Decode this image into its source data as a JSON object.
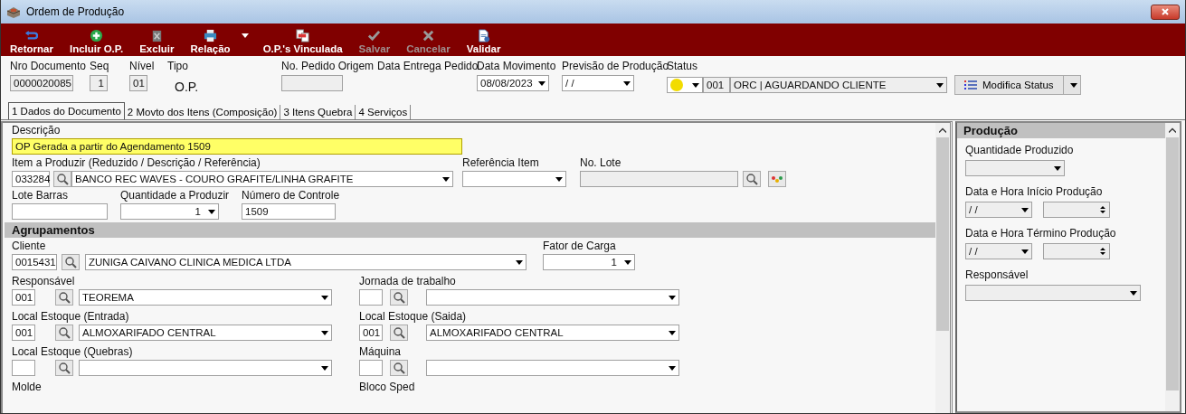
{
  "window": {
    "title": "Ordem de Produção"
  },
  "toolbar": [
    {
      "label": "Retornar",
      "disabled": false,
      "has_menu": false
    },
    {
      "label": "Incluir O.P.",
      "disabled": false,
      "has_menu": false
    },
    {
      "label": "Excluir",
      "disabled": false,
      "has_menu": false
    },
    {
      "label": "Relação",
      "disabled": false,
      "has_menu": true
    },
    {
      "label": "O.P.'s Vinculada",
      "disabled": false,
      "has_menu": false
    },
    {
      "label": "Salvar",
      "disabled": true,
      "has_menu": false
    },
    {
      "label": "Cancelar",
      "disabled": true,
      "has_menu": false
    },
    {
      "label": "Validar",
      "disabled": false,
      "has_menu": false
    }
  ],
  "header": {
    "nro_documento": {
      "label": "Nro Documento",
      "value": "0000020085"
    },
    "seq": {
      "label": "Seq",
      "value": "1"
    },
    "nivel": {
      "label": "Nível",
      "value": "01"
    },
    "tipo": {
      "label": "Tipo",
      "value": "O.P."
    },
    "pedido_origem": {
      "label": "No. Pedido Origem"
    },
    "data_entrega": {
      "label": "Data Entrega Pedido"
    },
    "data_movimento": {
      "label": "Data Movimento",
      "value": "08/08/2023"
    },
    "previsao": {
      "label": "Previsão de Produção",
      "value": "/ /"
    },
    "status": {
      "label": "Status",
      "color": "#f2dc00",
      "code": "001",
      "value": "ORC | AGUARDANDO CLIENTE"
    },
    "modifica_status": "Modifica Status"
  },
  "tabs": [
    {
      "label": "1 Dados do Documento",
      "selected": true
    },
    {
      "label": "2 Movto dos Itens (Composição)",
      "selected": false
    },
    {
      "label": "3 Itens Quebra",
      "selected": false
    },
    {
      "label": "4 Serviços",
      "selected": false
    }
  ],
  "documento": {
    "descricao": {
      "label": "Descrição",
      "value": "OP Gerada a partir do Agendamento 1509"
    },
    "item": {
      "label": "Item a Produzir (Reduzido / Descrição / Referência)",
      "code": "033284",
      "value": "BANCO REC WAVES - COURO GRAFITE/LINHA GRAFITE"
    },
    "referencia": {
      "label": "Referência Item"
    },
    "lote": {
      "label": "No. Lote"
    },
    "lote_barras": {
      "label": "Lote Barras"
    },
    "quantidade": {
      "label": "Quantidade a Produzir",
      "value": "1"
    },
    "controle": {
      "label": "Número de Controle",
      "value": "1509"
    }
  },
  "agrupamentos": {
    "title": "Agrupamentos",
    "cliente": {
      "label": "Cliente",
      "code": "0015431",
      "value": "ZUNIGA CAIVANO CLINICA MEDICA LTDA"
    },
    "fator_carga": {
      "label": "Fator de Carga",
      "value": "1"
    },
    "pairs": [
      [
        {
          "label": "Responsável",
          "code": "001",
          "value": "TEOREMA"
        },
        {
          "label": "Jornada de trabalho"
        }
      ],
      [
        {
          "label": "Local Estoque (Entrada)",
          "code": "001",
          "value": "ALMOXARIFADO CENTRAL"
        },
        {
          "label": "Local Estoque (Saida)",
          "code": "001",
          "value": "ALMOXARIFADO CENTRAL"
        }
      ],
      [
        {
          "label": "Local Estoque (Quebras)"
        },
        {
          "label": "Máquina"
        }
      ]
    ],
    "molde": {
      "label": "Molde"
    },
    "bloco_sped": {
      "label": "Bloco Sped"
    }
  },
  "producao": {
    "title": "Produção",
    "quantidade": {
      "label": "Quantidade Produzido"
    },
    "inicio": {
      "label": "Data e Hora Início Produção",
      "date": "/ /"
    },
    "termino": {
      "label": "Data e Hora Término Produção",
      "date": "/ /"
    },
    "responsavel": {
      "label": "Responsável"
    }
  }
}
